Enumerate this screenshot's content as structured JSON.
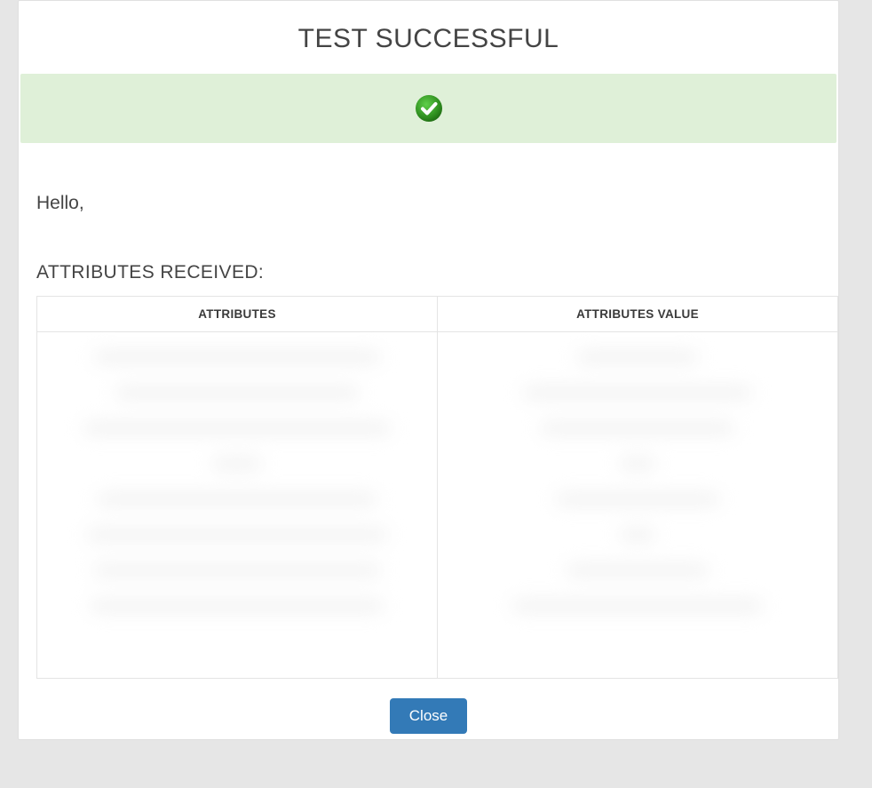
{
  "header": {
    "title": "TEST SUCCESSFUL"
  },
  "status": {
    "icon_name": "success-check-icon",
    "band_color": "#dff0d8",
    "check_color": "#2f8f1f"
  },
  "body": {
    "greeting": "Hello,",
    "attributes_heading": "ATTRIBUTES RECEIVED:"
  },
  "table": {
    "columns": [
      "ATTRIBUTES",
      "ATTRIBUTES VALUE"
    ],
    "rows": []
  },
  "actions": {
    "close_label": "Close"
  }
}
